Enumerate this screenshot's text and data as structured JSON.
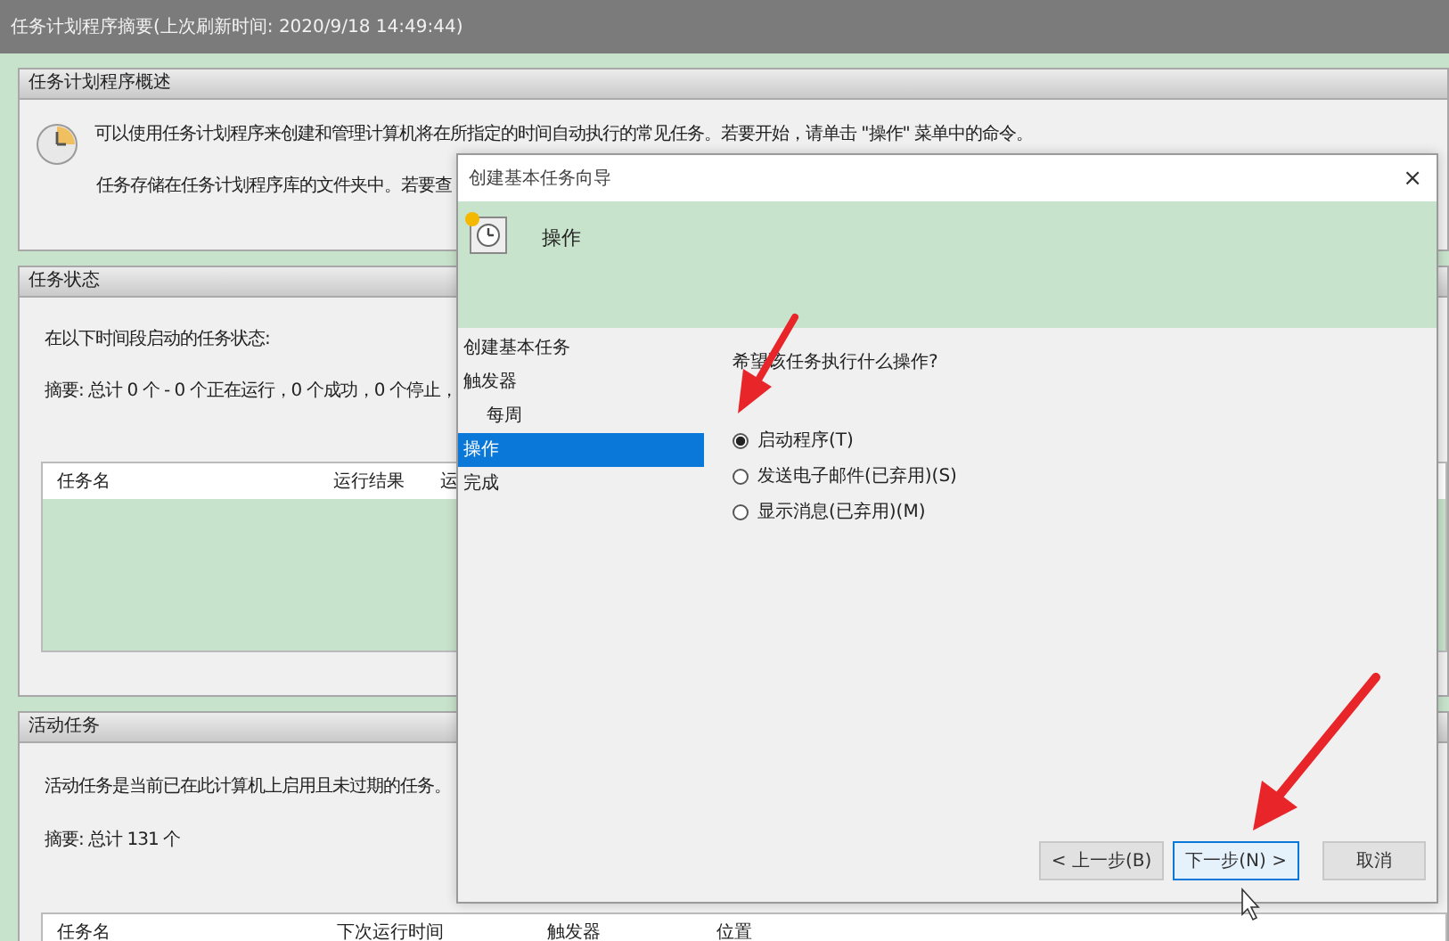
{
  "window": {
    "title": "任务计划程序摘要(上次刷新时间: 2020/9/18 14:49:44)"
  },
  "overview": {
    "heading": "任务计划程序概述",
    "lines": [
      "可以使用任务计划程序来创建和管理计算机将在所指定的时间自动执行的常见任务。若要开始，请单击 \"操作\" 菜单中的命令。",
      "任务存储在任务计划程序库的文件夹中。若要查"
    ]
  },
  "status": {
    "heading": "任务状态",
    "lines": [
      "在以下时间段启动的任务状态:",
      "摘要: 总计 0 个 - 0 个正在运行，0 个成功，0 个停止，"
    ],
    "table": {
      "columns": [
        "任务名",
        "运行结果",
        "运"
      ]
    }
  },
  "active": {
    "heading": "活动任务",
    "lines": [
      "活动任务是当前已在此计算机上启用且未过期的任务。",
      "摘要: 总计 131 个"
    ],
    "table": {
      "columns": [
        "任务名",
        "下次运行时间",
        "触发器",
        "位置"
      ]
    }
  },
  "dialog": {
    "title": "创建基本任务向导",
    "close": "×",
    "header": "操作",
    "steps": [
      {
        "label": "创建基本任务",
        "selected": false
      },
      {
        "label": "触发器",
        "selected": false,
        "children": [
          {
            "label": "每周",
            "selected": false
          }
        ]
      },
      {
        "label": "操作",
        "selected": true
      },
      {
        "label": "完成",
        "selected": false
      }
    ],
    "question": "希望该任务执行什么操作?",
    "options": [
      {
        "label": "启动程序(T)",
        "selected": true
      },
      {
        "label": "发送电子邮件(已弃用)(S)",
        "selected": false
      },
      {
        "label": "显示消息(已弃用)(M)",
        "selected": false
      }
    ],
    "buttons": [
      {
        "label": "< 上一步(B)",
        "focused": false
      },
      {
        "label": "下一步(N) >",
        "focused": true
      },
      {
        "label": "取消",
        "focused": false
      }
    ]
  }
}
